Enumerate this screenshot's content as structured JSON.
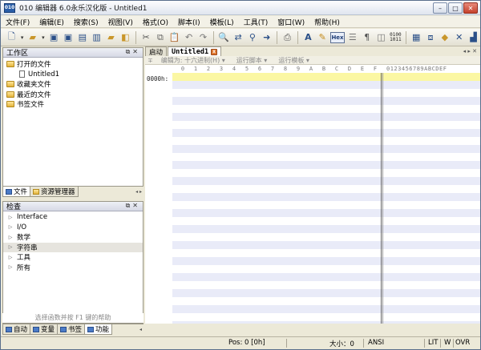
{
  "window": {
    "title": "010 编辑器 6.0永乐汉化版 - Untitled1",
    "app_icon": "010"
  },
  "menu": [
    "文件(F)",
    "编辑(E)",
    "搜索(S)",
    "视图(V)",
    "格式(O)",
    "脚本(I)",
    "模板(L)",
    "工具(T)",
    "窗口(W)",
    "帮助(H)"
  ],
  "toolbar": {
    "hex_label": "Hex",
    "bin_label": "0100\n1011"
  },
  "workspace": {
    "title": "工作区",
    "items": [
      {
        "label": "打开的文件",
        "type": "folder",
        "indent": 0
      },
      {
        "label": "Untitled1",
        "type": "file",
        "indent": 1
      },
      {
        "label": "收藏夹文件",
        "type": "folder",
        "indent": 0
      },
      {
        "label": "最近的文件",
        "type": "folder",
        "indent": 0
      },
      {
        "label": "书签文件",
        "type": "folder",
        "indent": 0
      }
    ],
    "tabs": [
      "文件",
      "资源管理器"
    ]
  },
  "inspector": {
    "title": "检查",
    "items": [
      "Interface",
      "I/O",
      "数学",
      "字符串",
      "工具",
      "所有"
    ],
    "selected_index": 3,
    "hint": "选择函数并按 F1 键的帮助",
    "tabs": [
      "自动",
      "变量",
      "书签",
      "功能"
    ]
  },
  "editor": {
    "doc_tabs": [
      "启动",
      "Untitled1"
    ],
    "bar": [
      "编辑为: 十六进制(H)",
      "运行脚本",
      "运行模板"
    ],
    "hex_columns": [
      "0",
      "1",
      "2",
      "3",
      "4",
      "5",
      "6",
      "7",
      "8",
      "9",
      "A",
      "B",
      "C",
      "D",
      "E",
      "F"
    ],
    "ascii_header": "0123456789ABCDEF",
    "offset": "0000h:"
  },
  "status": {
    "pos": "Pos: 0 [0h]",
    "size": "大小：0",
    "encoding": "ANSI",
    "lit": "LIT",
    "w": "W",
    "ovr": "OVR"
  }
}
